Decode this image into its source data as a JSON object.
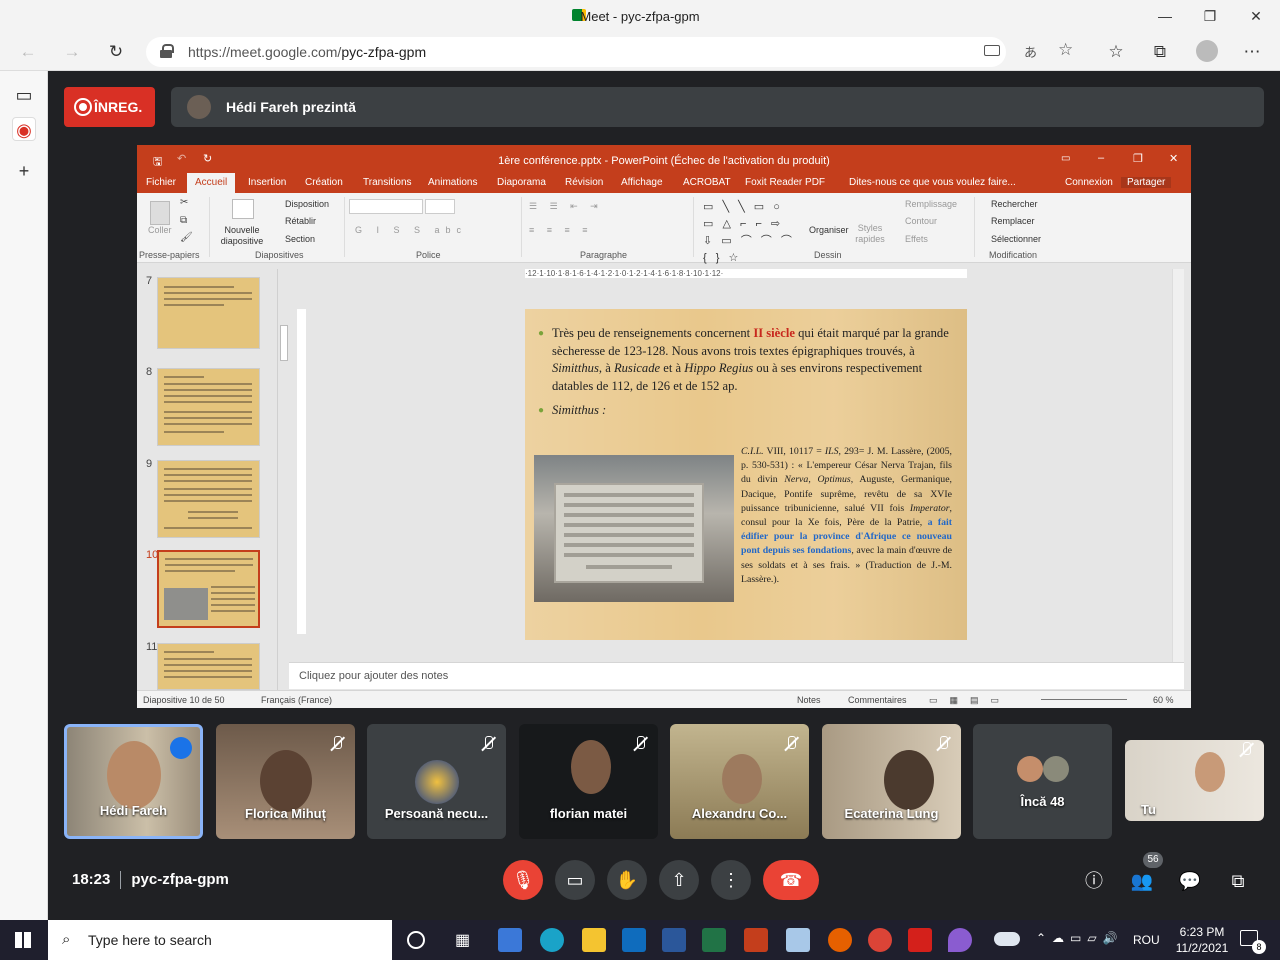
{
  "browser": {
    "window_title": "Meet - pyc-zfpa-gpm",
    "url_host": "https://meet.google.com/",
    "url_path": "pyc-zfpa-gpm"
  },
  "meet": {
    "rec_label": "ÎNREG.",
    "presenter_label": "Hédi Fareh prezintă",
    "meeting_time": "18:23",
    "meeting_code": "pyc-zfpa-gpm",
    "participants_count": "56"
  },
  "ppt": {
    "title": "1ère conférence.pptx - PowerPoint (Échec de l'activation du produit)",
    "tabs": [
      "Fichier",
      "Accueil",
      "Insertion",
      "Création",
      "Transitions",
      "Animations",
      "Diaporama",
      "Révision",
      "Affichage",
      "ACROBAT",
      "Foxit Reader PDF",
      "Dites-nous ce que vous voulez faire..."
    ],
    "account": {
      "signin": "Connexion",
      "share": "Partager"
    },
    "ribbon": {
      "coller": "Coller",
      "nouvelle_diapo": "Nouvelle diapositive",
      "disposition": "Disposition",
      "retablir": "Rétablir",
      "section": "Section",
      "organiser": "Organiser",
      "styles_rapides": "Styles rapides",
      "remplissage": "Remplissage",
      "contour": "Contour",
      "effets": "Effets",
      "rechercher": "Rechercher",
      "remplacer": "Remplacer",
      "selectionner": "Sélectionner",
      "groups": [
        "Presse-papiers",
        "Diapositives",
        "Police",
        "Paragraphe",
        "Dessin",
        "Modification"
      ]
    },
    "ruler": "·12·1·10·1·8·1·6·1·4·1·2·1·0·1·2·1·4·1·6·1·8·1·10·1·12·",
    "thumb_numbers": [
      "7",
      "8",
      "9",
      "10",
      "11"
    ],
    "slide": {
      "p1_a": "Très peu de renseignements concernent ",
      "p1_red": "II siècle",
      "p1_b": " qui était marqué par la grande sècheresse de 123-128. Nous avons trois textes épigraphiques trouvés, à ",
      "p1_i1": "Simitthus",
      "p1_c": ", à ",
      "p1_i2": "Rusicade",
      "p1_d": " et à ",
      "p1_i3": "Hippo Regius",
      "p1_e": " ou à ses environs respectivement datables de 112, de 126 et de 152 ap.",
      "p2": "Simitthus :",
      "p3_a": "C.I.L.",
      "p3_b": " VIII, 10117 = ",
      "p3_c": "ILS",
      "p3_d": ", 293= J. M. Lassère, (2005, p. 530-531)  :  « L'empereur César Nerva Trajan, fils du divin ",
      "p3_e": "Nerva",
      "p3_f": ", ",
      "p3_g": "Optimus",
      "p3_h": ", Auguste, Germanique, Dacique, Pontife suprême, revêtu de sa XVIe puissance tribunicienne, salué VII fois ",
      "p3_i": "Imperator",
      "p3_j": ", consul pour la Xe fois, Père de la Patrie, ",
      "p3_blue": "a fait édifier pour la province d'Afrique ce nouveau pont depuis ses fondations",
      "p3_k": ", avec la main d'œuvre de ses soldats et à ses frais. » (Traduction de J.-M. Lassère.)."
    },
    "notes_placeholder": "Cliquez pour ajouter des notes",
    "status": {
      "slide": "Diapositive 10 de 50",
      "lang": "Français (France)",
      "notes": "Notes",
      "comments": "Commentaires",
      "zoom": "60 %"
    }
  },
  "participants": [
    {
      "name": "Hédi Fareh"
    },
    {
      "name": "Florica Mihuț"
    },
    {
      "name": "Persoană necu..."
    },
    {
      "name": "florian matei"
    },
    {
      "name": "Alexandru Co..."
    },
    {
      "name": "Ecaterina Lung"
    },
    {
      "name": "Încă 48"
    },
    {
      "name": "Tu"
    }
  ],
  "taskbar": {
    "search_placeholder": "Type here to search",
    "lang": "ROU",
    "time": "6:23 PM",
    "date": "11/2/2021",
    "notif_count": "8"
  }
}
